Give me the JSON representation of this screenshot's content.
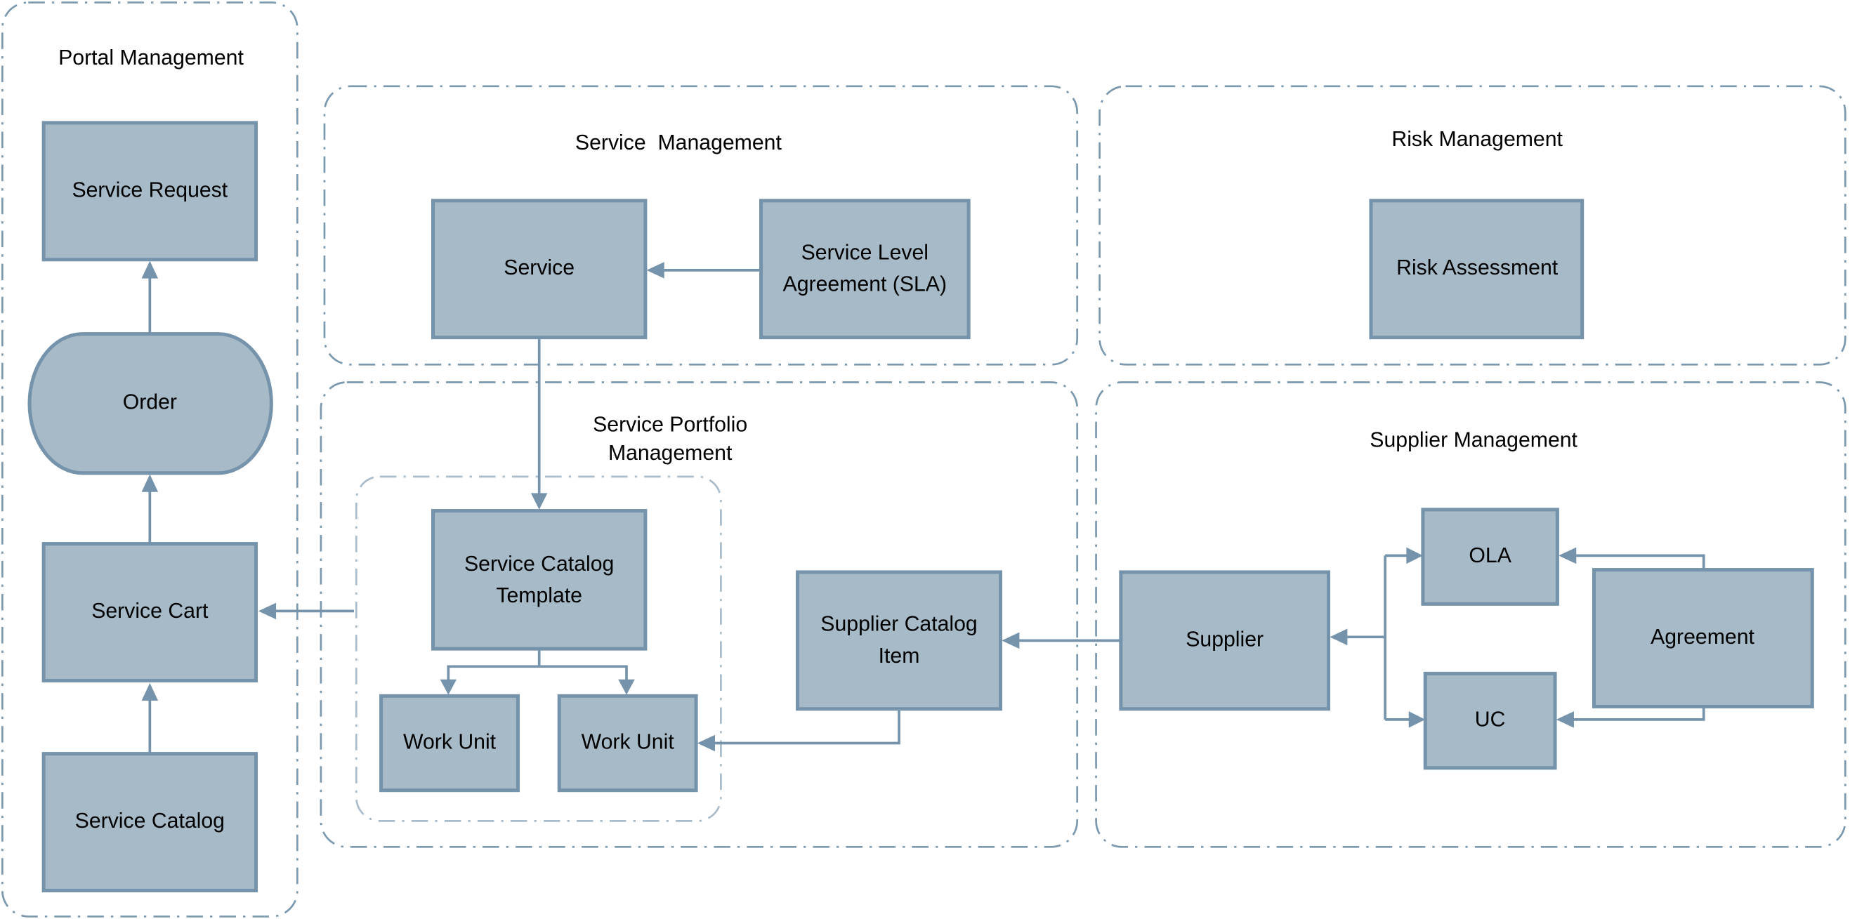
{
  "colors": {
    "box_fill": "#a7bac8",
    "box_stroke": "#7593aa",
    "group_border": "#7a98ae"
  },
  "groups": {
    "portal": {
      "title": "Portal Management"
    },
    "service": {
      "title": "Service  Management"
    },
    "risk": {
      "title": "Risk Management"
    },
    "portfolio": {
      "title_line1": "Service Portfolio",
      "title_line2": "Management"
    },
    "supplier": {
      "title": "Supplier Management"
    }
  },
  "nodes": {
    "service_request": "Service Request",
    "order": "Order",
    "service_cart": "Service Cart",
    "service_catalog": "Service Catalog",
    "service": "Service",
    "sla_line1": "Service Level",
    "sla_line2": "Agreement (SLA)",
    "risk_assessment": "Risk Assessment",
    "catalog_template_line1": "Service Catalog",
    "catalog_template_line2": "Template",
    "work_unit_1": "Work Unit",
    "work_unit_2": "Work Unit",
    "supplier_catalog_item_line1": "Supplier Catalog",
    "supplier_catalog_item_line2": "Item",
    "supplier": "Supplier",
    "ola": "OLA",
    "uc": "UC",
    "agreement": "Agreement"
  }
}
